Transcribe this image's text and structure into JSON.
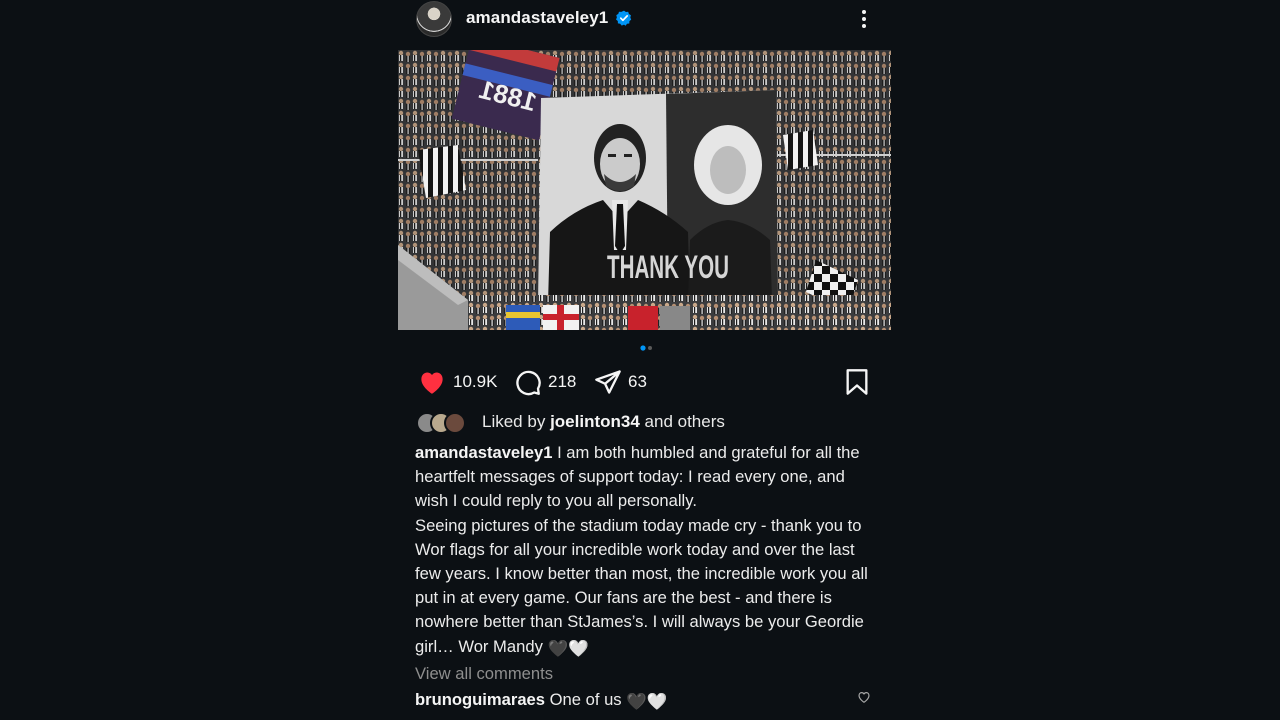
{
  "post": {
    "username": "amandastaveley1",
    "verified": true,
    "image_banner_text": "THANK YOU",
    "image_flag_text": "1881",
    "carousel": {
      "count": 2,
      "active": 0
    }
  },
  "actions": {
    "likes": "10.9K",
    "comments": "218",
    "shares": "63"
  },
  "liked_by": {
    "prefix": "Liked by",
    "user": "joelinton34",
    "suffix": "and others"
  },
  "caption": {
    "username": "amandastaveley1",
    "text": "I am both humbled and grateful for all the heartfelt messages of support today: I read every one, and wish I could reply to you all personally.\nSeeing pictures of the stadium today made cry - thank you to Wor flags for all your incredible work today and over the last few years. I know better than most, the incredible work you all put in at every game. Our fans are the best - and there is nowhere better than StJames’s. I will always be your Geordie girl… Wor Mandy",
    "emoji": "🖤🤍"
  },
  "view_all_comments": "View all comments",
  "top_comment": {
    "username": "brunoguimaraes",
    "text": "One of us",
    "emoji": "🖤🤍"
  },
  "colors": {
    "background": "#0c1014",
    "like_red": "#ff3040",
    "verified_blue": "#0095f6",
    "muted": "#8e8e8e"
  }
}
